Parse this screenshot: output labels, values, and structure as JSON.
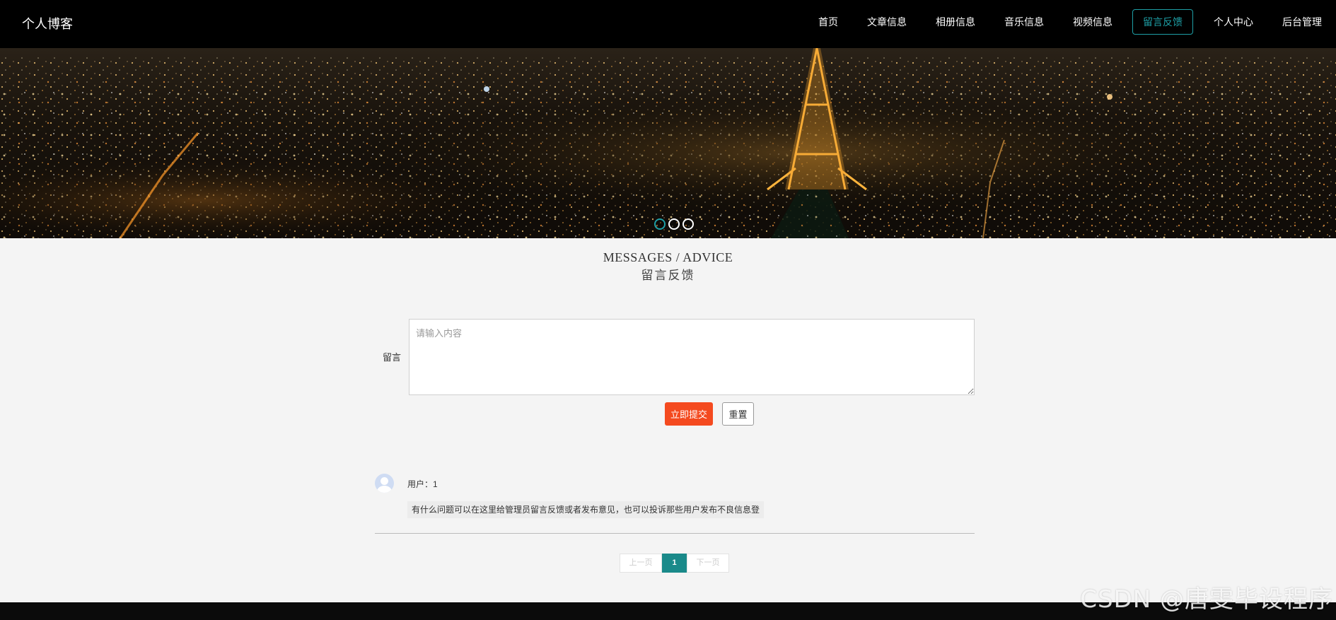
{
  "header": {
    "brand": "个人博客",
    "nav": [
      "首页",
      "文章信息",
      "相册信息",
      "音乐信息",
      "视频信息",
      "留言反馈",
      "个人中心",
      "后台管理"
    ],
    "active_nav": "留言反馈"
  },
  "banner": {
    "slides": 3,
    "active_slide": 1
  },
  "section": {
    "title_en": "MESSAGES / ADVICE",
    "title_cn": "留言反馈"
  },
  "form": {
    "label": "留言",
    "placeholder": "请输入内容",
    "value": "",
    "submit_label": "立即提交",
    "reset_label": "重置"
  },
  "comments": [
    {
      "user": "用户：1",
      "text": "有什么问题可以在这里给管理员留言反馈或者发布意见，也可以投诉那些用户发布不良信息登"
    }
  ],
  "pagination": {
    "prev_label": "上一页",
    "current_page": "1",
    "next_label": "下一页"
  },
  "watermark": "CSDN @唐雯毕设程序",
  "colors": {
    "header_bg": "#000000",
    "accent": "#1e9fa6",
    "submit": "#f44a1f",
    "page_active": "#1a8a8a",
    "page_bg": "#f4f4f4"
  }
}
